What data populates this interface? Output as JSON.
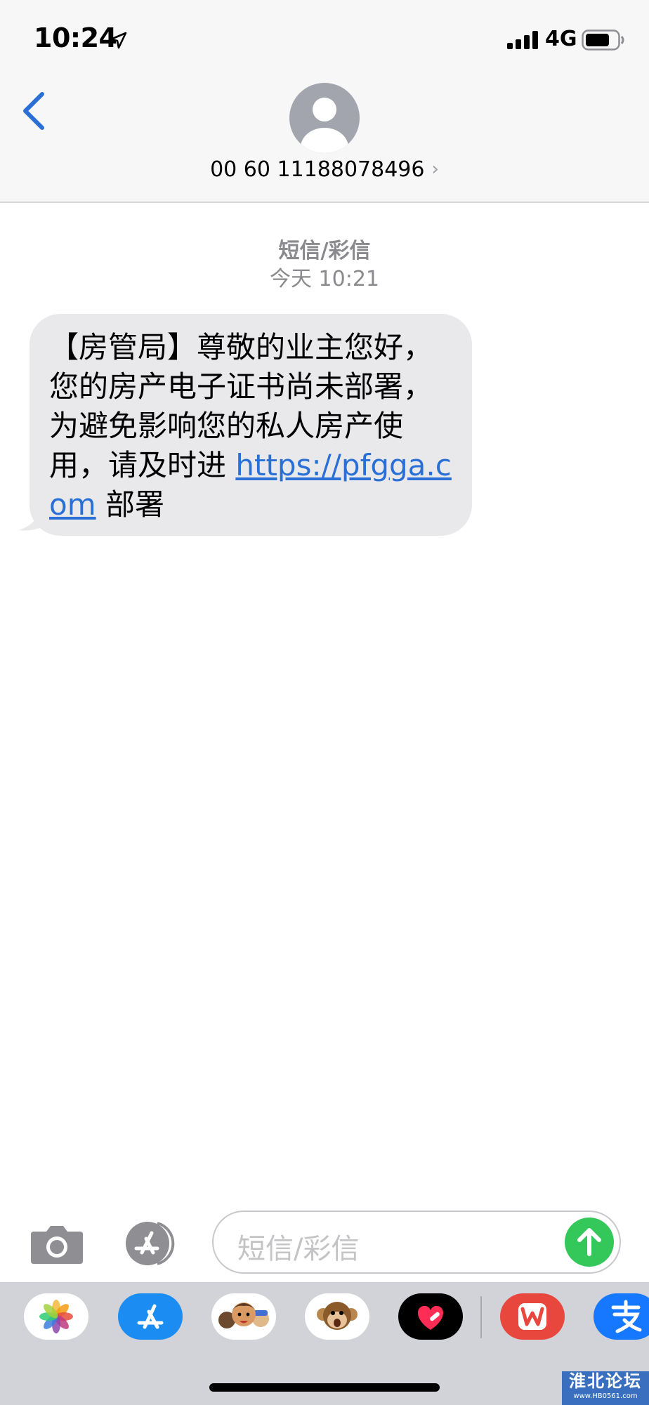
{
  "status_bar": {
    "time": "10:24",
    "network": "4G",
    "icons": [
      "location-arrow-icon",
      "cellular-signal-icon",
      "battery-icon"
    ]
  },
  "nav": {
    "back_icon": "chevron-left-icon",
    "avatar_icon": "person-silhouette-icon",
    "contact": "00 60 11188078496",
    "contact_chevron": "›"
  },
  "thread": {
    "service_label": "短信/彩信",
    "timestamp": "今天 10:21",
    "message": {
      "text_before": "【房管局】尊敬的业主您好，您的房产电子证书尚未部署，为避免影响您的私人房产使用，请及时进 ",
      "link": "https://pfgga.com",
      "text_after": " 部署"
    }
  },
  "compose": {
    "placeholder": "短信/彩信",
    "camera_icon": "camera-icon",
    "appstore_icon": "app-store-icon",
    "send_icon": "arrow-up-icon"
  },
  "app_drawer": {
    "apps": [
      "photos-icon",
      "app-store-icon",
      "memoji-icon",
      "animoji-monkey-icon",
      "digital-touch-heart-icon",
      "wps-office-icon",
      "alipay-icon"
    ]
  },
  "watermark": {
    "title": "淮北论坛",
    "url": "www.HB0561.com"
  },
  "colors": {
    "accent_blue": "#2a6fd6",
    "send_green": "#34c759",
    "bubble_gray": "#e9e9eb"
  }
}
